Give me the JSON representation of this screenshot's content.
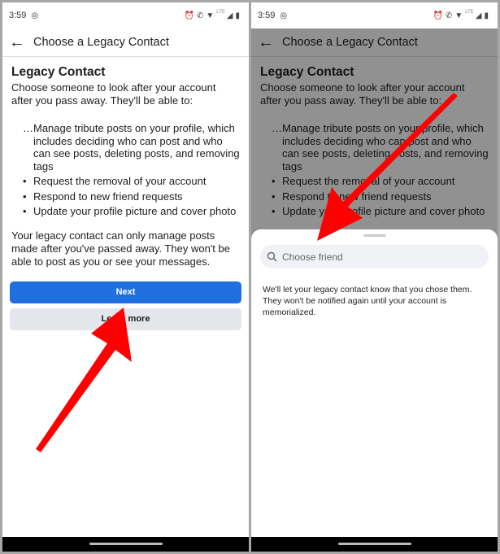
{
  "status": {
    "time": "3:59",
    "network": "LTE"
  },
  "appbar": {
    "title": "Choose a Legacy Contact"
  },
  "content": {
    "heading": "Legacy Contact",
    "intro": "Choose someone to look after your account after you pass away. They'll be able to:",
    "items": [
      "Manage tribute posts on your profile, which includes deciding who can post and who can see posts, deleting posts, and removing tags",
      "Request the removal of your account",
      "Respond to new friend requests",
      "Update your profile picture and cover photo"
    ],
    "note": "Your legacy contact can only manage posts made after you've passed away. They won't be able to post as you or see your messages.",
    "next_label": "Next",
    "learn_label": "Learn more"
  },
  "sheet": {
    "search_placeholder": "Choose friend",
    "message": "We'll let your legacy contact know that you chose them. They won't be notified again until your account is memorialized."
  },
  "colors": {
    "accent": "#1f6fe0",
    "arrow": "#ff0000"
  }
}
